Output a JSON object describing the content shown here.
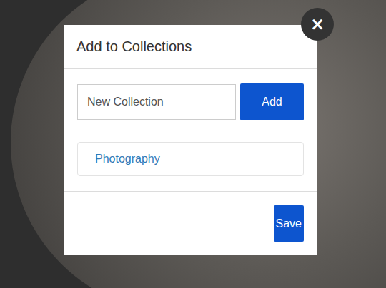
{
  "dialog": {
    "title": "Add to Collections",
    "close": "×"
  },
  "new_collection": {
    "placeholder": "New Collection"
  },
  "buttons": {
    "add": "Add",
    "save": "Save"
  },
  "collections": [
    {
      "name": "Photography"
    }
  ]
}
